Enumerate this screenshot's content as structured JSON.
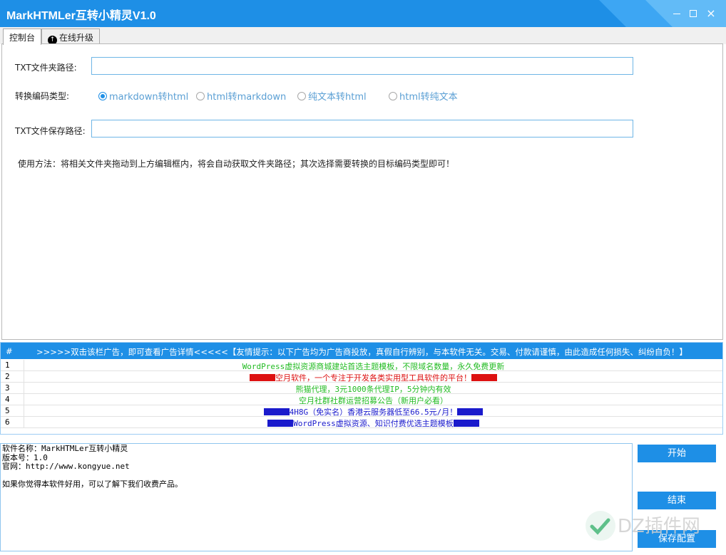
{
  "window": {
    "title": "MarkHTMLer互转小精灵V1.0",
    "close_glyph": "×"
  },
  "tabs": [
    {
      "label": "控制台",
      "active": true
    },
    {
      "label": "在线升级",
      "active": false
    }
  ],
  "form": {
    "folder_label": "TXT文件夹路径:",
    "folder_value": "",
    "type_label": "转换编码类型:",
    "options": [
      {
        "label": "markdown转html",
        "selected": true
      },
      {
        "label": "html转markdown",
        "selected": false
      },
      {
        "label": "纯文本转html",
        "selected": false
      },
      {
        "label": "html转纯文本",
        "selected": false
      }
    ],
    "save_label": "TXT文件保存路径:",
    "save_value": "",
    "usage": "使用方法：将相关文件夹拖动到上方编辑框内，将会自动获取文件夹路径；其次选择需要转换的目标编码类型即可！"
  },
  "ads": {
    "hash": "#",
    "header": ">>>>>双击该栏广告，即可查看广告详情<<<<<【友情提示：以下广告均为广告商投放，真假自行辨别，与本软件无关。交易、付款请谨慎，由此造成任何损失、纠纷自负！】",
    "rows": [
      {
        "num": "1",
        "text": "WordPress虚拟资源商城建站首选主题模板，不限域名数量，永久免费更新",
        "color": "#22bb22"
      },
      {
        "num": "2",
        "text": "空月软件，一个专注于开发各类实用型工具软件的平台！",
        "color": "#dd1111",
        "blocks": "#dd1111"
      },
      {
        "num": "3",
        "text": "熊猫代理，3元1000条代理IP，5分钟内有效",
        "color": "#22bb22"
      },
      {
        "num": "4",
        "text": "空月社群社群运营招募公告（新用户必看）",
        "color": "#22bb22"
      },
      {
        "num": "5",
        "text": "4H8G（免实名）香港云服务器低至66.5元/月！",
        "color": "#1a1acc",
        "blocks": "#1a1acc"
      },
      {
        "num": "6",
        "text": "WordPress虚拟资源、知识付费优选主题模板",
        "color": "#1a1acc",
        "blocks": "#1a1acc"
      }
    ]
  },
  "log": {
    "line1": "软件名称：MarkHTMLer互转小精灵",
    "line2": "版本号：1.0",
    "line3": "官网：http://www.kongyue.net",
    "line4": "如果你觉得本软件好用，可以了解下我们收费产品。"
  },
  "buttons": {
    "start": "开始",
    "end": "结束",
    "save": "保存配置"
  },
  "watermark": {
    "text": "DZ插件网"
  }
}
